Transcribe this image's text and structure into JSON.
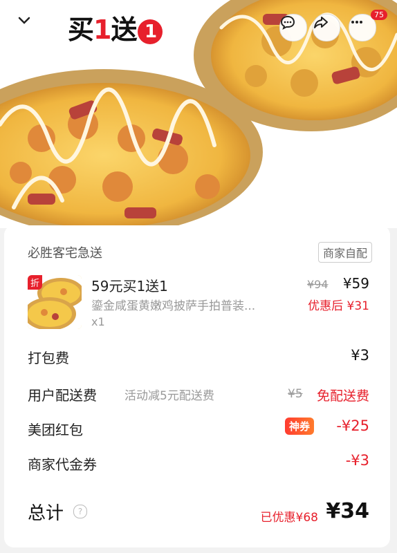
{
  "header": {
    "promo_main": "买",
    "promo_num": "1",
    "promo_send": "送",
    "promo_circle": "1",
    "message_count": "75"
  },
  "order": {
    "shop_name": "必胜客宅急送",
    "delivery_type": "商家自配",
    "item": {
      "title": "59元买1送1",
      "description": "鎏金咸蛋黄嫩鸡披萨手拍普装...",
      "quantity": "x1",
      "original_price": "¥94",
      "price": "¥59",
      "after_discount": "优惠后 ¥31",
      "discount_mark": "折"
    },
    "rows": {
      "packing_label": "打包费",
      "packing_value": "¥3",
      "delivery_label": "用户配送费",
      "delivery_note": "活动减5元配送费",
      "delivery_orig": "¥5",
      "delivery_value": "免配送费",
      "redpack_label": "美团红包",
      "redpack_badge": "神券",
      "redpack_value": "-¥25",
      "voucher_label": "商家代金券",
      "voucher_value": "-¥3"
    },
    "total": {
      "label": "总计",
      "help": "?",
      "saved": "已优惠¥68",
      "value": "¥34"
    }
  },
  "colors": {
    "accent_red": "#e7202c",
    "pizza_crust": "#d9a44a",
    "pizza_cheese": "#f4c84a"
  },
  "icons": [
    "chevron-down-icon",
    "chat-icon",
    "share-icon",
    "more-icon",
    "help-icon"
  ]
}
